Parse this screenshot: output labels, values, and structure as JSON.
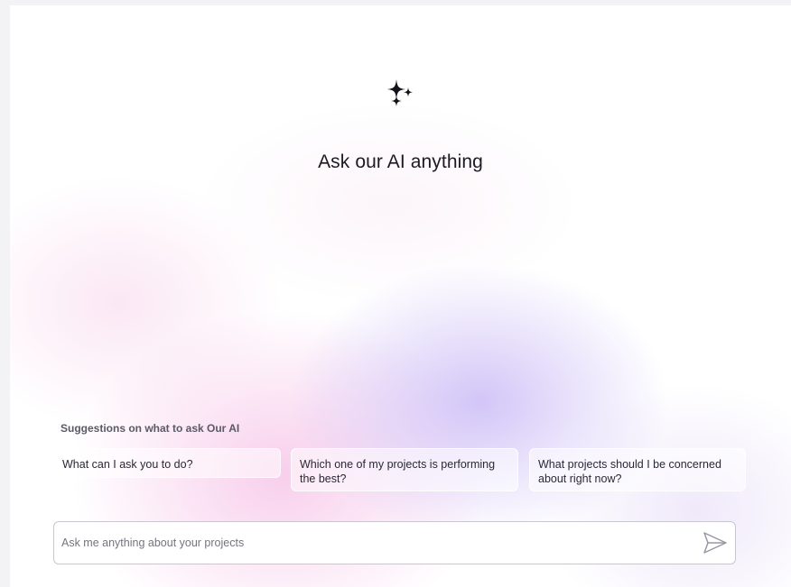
{
  "hero": {
    "icon": "sparkles-icon",
    "title": "Ask our AI anything"
  },
  "suggestions": {
    "label": "Suggestions on what to ask Our AI",
    "items": [
      {
        "text": "What can I ask you to do?"
      },
      {
        "text": "Which one of my projects is performing the best?"
      },
      {
        "text": "What projects should I be concerned about right now?"
      }
    ]
  },
  "composer": {
    "placeholder": "Ask me anything about your projects",
    "value": "",
    "send_icon": "send-icon"
  },
  "colors": {
    "accent_lavender": "#c4b2f5",
    "accent_pink": "#f5bae4",
    "text_primary": "#1c1b22",
    "border": "#c9c6d2"
  }
}
